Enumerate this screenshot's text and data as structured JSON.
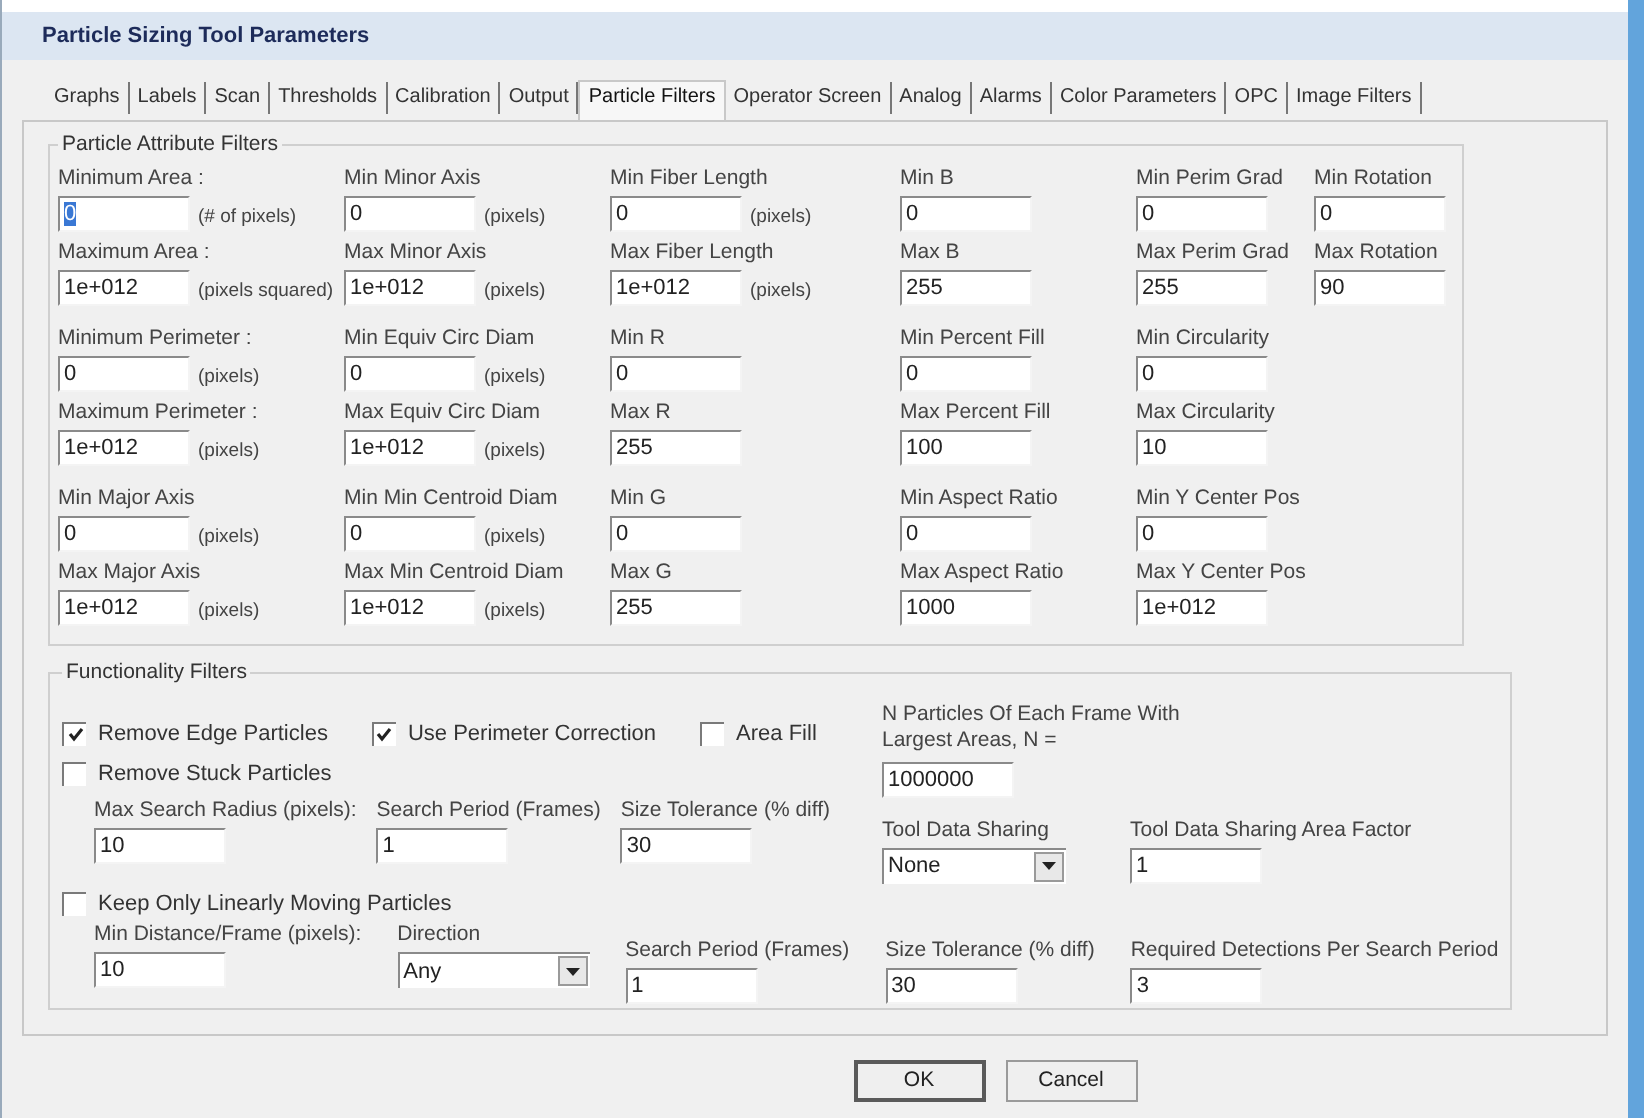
{
  "window": {
    "title": "Particle Sizing Tool Parameters"
  },
  "tabs": [
    {
      "label": "Graphs",
      "selected": false
    },
    {
      "label": "Labels",
      "selected": false
    },
    {
      "label": "Scan",
      "selected": false
    },
    {
      "label": "Thresholds",
      "selected": false
    },
    {
      "label": "Calibration",
      "selected": false
    },
    {
      "label": "Output",
      "selected": false
    },
    {
      "label": "Particle Filters",
      "selected": true
    },
    {
      "label": "Operator Screen",
      "selected": false
    },
    {
      "label": "Analog",
      "selected": false
    },
    {
      "label": "Alarms",
      "selected": false
    },
    {
      "label": "Color Parameters",
      "selected": false
    },
    {
      "label": "OPC",
      "selected": false
    },
    {
      "label": "Image Filters",
      "selected": false
    }
  ],
  "attribute_filters": {
    "title": "Particle Attribute Filters",
    "columns": [
      {
        "groups": [
          {
            "fields": [
              {
                "label": "Minimum Area :",
                "value": "0",
                "unit": "(# of pixels)",
                "selected": true
              },
              {
                "label": "Maximum Area :",
                "value": "1e+012",
                "unit": "(pixels squared)",
                "selected": false
              }
            ]
          },
          {
            "fields": [
              {
                "label": "Minimum Perimeter :",
                "value": "0",
                "unit": "(pixels)",
                "selected": false
              },
              {
                "label": "Maximum Perimeter :",
                "value": "1e+012",
                "unit": "(pixels)",
                "selected": false
              }
            ]
          },
          {
            "fields": [
              {
                "label": "Min Major Axis",
                "value": "0",
                "unit": "(pixels)",
                "selected": false
              },
              {
                "label": "Max Major Axis",
                "value": "1e+012",
                "unit": "(pixels)",
                "selected": false
              }
            ]
          }
        ]
      },
      {
        "groups": [
          {
            "fields": [
              {
                "label": "Min Minor Axis",
                "value": "0",
                "unit": "(pixels)",
                "selected": false
              },
              {
                "label": "Max Minor Axis",
                "value": "1e+012",
                "unit": "(pixels)",
                "selected": false
              }
            ]
          },
          {
            "fields": [
              {
                "label": "Min Equiv Circ Diam",
                "value": "0",
                "unit": "(pixels)",
                "selected": false
              },
              {
                "label": "Max Equiv Circ Diam",
                "value": "1e+012",
                "unit": "(pixels)",
                "selected": false
              }
            ]
          },
          {
            "fields": [
              {
                "label": "Min Min Centroid Diam",
                "value": "0",
                "unit": "(pixels)",
                "selected": false
              },
              {
                "label": "Max Min Centroid Diam",
                "value": "1e+012",
                "unit": "(pixels)",
                "selected": false
              }
            ]
          }
        ]
      },
      {
        "groups": [
          {
            "fields": [
              {
                "label": "Min Fiber Length",
                "value": "0",
                "unit": "(pixels)",
                "selected": false
              },
              {
                "label": "Max Fiber Length",
                "value": "1e+012",
                "unit": "(pixels)",
                "selected": false
              }
            ]
          },
          {
            "fields": [
              {
                "label": "Min R",
                "value": "0",
                "selected": false
              },
              {
                "label": "Max R",
                "value": "255",
                "selected": false
              }
            ]
          },
          {
            "fields": [
              {
                "label": "Min G",
                "value": "0",
                "selected": false
              },
              {
                "label": "Max G",
                "value": "255",
                "selected": false
              }
            ]
          }
        ]
      },
      {
        "groups": [
          {
            "fields": [
              {
                "label": "Min B",
                "value": "0",
                "selected": false
              },
              {
                "label": "Max B",
                "value": "255",
                "selected": false
              }
            ]
          },
          {
            "fields": [
              {
                "label": "Min Percent Fill",
                "value": "0",
                "selected": false
              },
              {
                "label": "Max Percent Fill",
                "value": "100",
                "selected": false
              }
            ]
          },
          {
            "fields": [
              {
                "label": "Min Aspect Ratio",
                "value": "0",
                "selected": false
              },
              {
                "label": "Max Aspect Ratio",
                "value": "1000",
                "selected": false
              }
            ]
          }
        ]
      },
      {
        "groups": [
          {
            "fields": [
              {
                "label": "Min Perim Grad",
                "value": "0",
                "selected": false
              },
              {
                "label": "Max Perim Grad",
                "value": "255",
                "selected": false
              }
            ]
          },
          {
            "fields": [
              {
                "label": "Min Circularity",
                "value": "0",
                "selected": false
              },
              {
                "label": "Max Circularity",
                "value": "10",
                "selected": false
              }
            ]
          },
          {
            "fields": [
              {
                "label": "Min Y Center Pos",
                "value": "0",
                "selected": false
              },
              {
                "label": "Max Y Center Pos",
                "value": "1e+012",
                "selected": false
              }
            ]
          }
        ]
      },
      {
        "groups": [
          {
            "fields": [
              {
                "label": "Min Rotation",
                "value": "0",
                "selected": false
              },
              {
                "label": "Max Rotation",
                "value": "90",
                "selected": false
              }
            ]
          }
        ]
      }
    ]
  },
  "functionality_filters": {
    "title": "Functionality Filters",
    "options": [
      {
        "label": "Remove Edge Particles",
        "checked": true
      },
      {
        "label": "Use Perimeter Correction",
        "checked": true
      },
      {
        "label": "Area Fill",
        "checked": false
      }
    ],
    "n_particles": {
      "label": "N Particles Of Each Frame With Largest Areas, N =",
      "value": "1000000"
    },
    "remove_stuck": {
      "label": "Remove Stuck Particles",
      "checked": false,
      "fields": [
        {
          "kind": "input",
          "label": "Max Search Radius (pixels):",
          "value": "10"
        },
        {
          "kind": "input",
          "label": "Search Period (Frames)",
          "value": "1"
        },
        {
          "kind": "input",
          "label": "Size Tolerance (% diff)",
          "value": "30"
        }
      ]
    },
    "tool_data_sharing": [
      {
        "kind": "select",
        "label": "Tool Data Sharing",
        "value": "None"
      },
      {
        "kind": "input",
        "label": "Tool Data Sharing Area Factor",
        "value": "1"
      }
    ],
    "keep_linear": {
      "label": "Keep  Only Linearly Moving Particles",
      "checked": false,
      "fields": [
        {
          "kind": "input",
          "label": "Min Distance/Frame (pixels):",
          "value": "10"
        },
        {
          "kind": "select",
          "label": "Direction",
          "value": "Any"
        },
        {
          "kind": "input",
          "label": "Search Period (Frames)",
          "value": "1"
        },
        {
          "kind": "input",
          "label": "Size Tolerance (% diff)",
          "value": "30"
        },
        {
          "kind": "input",
          "label": "Required Detections Per Search Period",
          "value": "3"
        }
      ]
    }
  },
  "buttons": [
    {
      "label": "OK",
      "default": true
    },
    {
      "label": "Cancel",
      "default": false
    }
  ]
}
